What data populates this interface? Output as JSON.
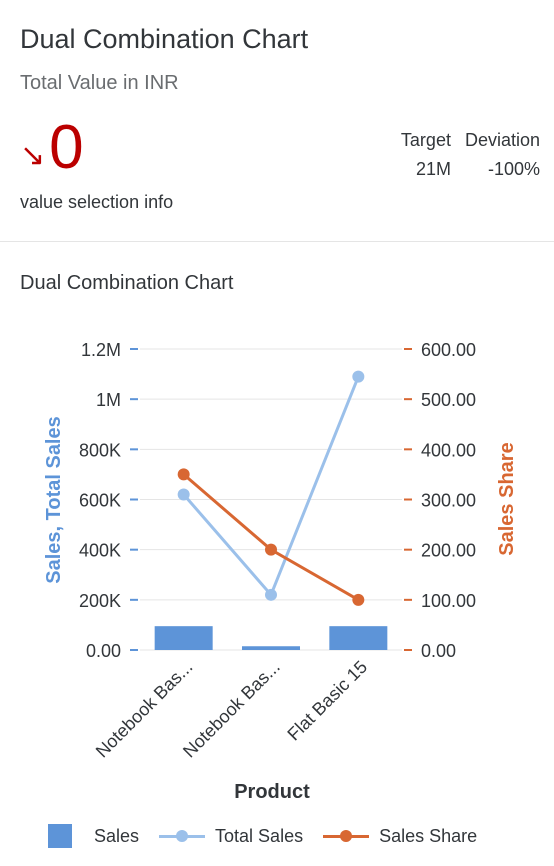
{
  "header": {
    "title": "Dual Combination Chart",
    "subtitle": "Total Value in INR",
    "kpi_value": "0",
    "trend_icon": "arrow-down-right-icon",
    "value_info": "value selection info",
    "target_label": "Target",
    "target_value": "21M",
    "deviation_label": "Deviation",
    "deviation_value": "-100%"
  },
  "colors": {
    "sales": "#5d94d8",
    "total_sales": "#9bc0ea",
    "sales_share": "#d86732",
    "negative": "#bb0000"
  },
  "chart_data": {
    "type": "bar",
    "title": "Dual Combination Chart",
    "xlabel": "Product",
    "ylabel": "Sales, Total Sales",
    "y2label": "Sales Share",
    "categories": [
      "Notebook Bas...",
      "Notebook Bas...",
      "Flat Basic 15"
    ],
    "ylim": [
      0,
      1200000
    ],
    "y2lim": [
      0,
      600
    ],
    "y_ticks": [
      "0.00",
      "200K",
      "400K",
      "600K",
      "800K",
      "1M",
      "1.2M"
    ],
    "y2_ticks": [
      "0.00",
      "100.00",
      "200.00",
      "300.00",
      "400.00",
      "500.00",
      "600.00"
    ],
    "series": [
      {
        "name": "Sales",
        "type": "bar",
        "axis": "left",
        "values": [
          95000,
          15000,
          95000
        ]
      },
      {
        "name": "Total Sales",
        "type": "line",
        "axis": "left",
        "values": [
          620000,
          220000,
          1090000
        ]
      },
      {
        "name": "Sales Share",
        "type": "line",
        "axis": "right",
        "values": [
          350,
          200,
          100
        ]
      }
    ],
    "legend_position": "bottom",
    "grid": true
  }
}
